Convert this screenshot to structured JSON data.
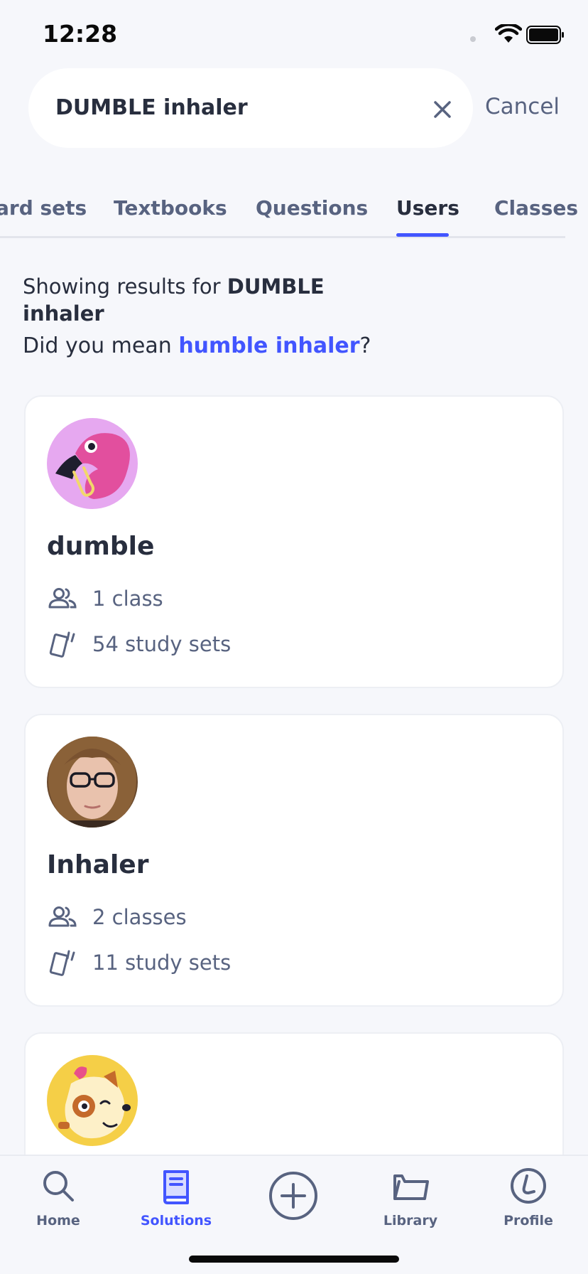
{
  "status_bar": {
    "time": "12:28"
  },
  "search": {
    "query": "DUMBLE inhaler",
    "cancel_label": "Cancel"
  },
  "tabs": [
    {
      "label": "ard sets"
    },
    {
      "label": "Textbooks"
    },
    {
      "label": "Questions"
    },
    {
      "label": "Users",
      "active": true
    },
    {
      "label": "Classes"
    }
  ],
  "results": {
    "showing_prefix": "Showing results for",
    "query": "DUMBLE inhaler",
    "did_you_mean_prefix": "Did you mean",
    "suggestion": "humble inhaler",
    "suggestion_suffix": "?"
  },
  "users": [
    {
      "name": "dumble",
      "classes": "1 class",
      "study_sets": "54 study sets",
      "avatar": "flamingo-avatar"
    },
    {
      "name": "Inhaler",
      "classes": "2 classes",
      "study_sets": "11 study sets",
      "avatar": "photo-avatar"
    },
    {
      "name": "",
      "avatar": "dog-avatar"
    }
  ],
  "bottom_nav": [
    {
      "label": "Home",
      "icon": "search-icon"
    },
    {
      "label": "Solutions",
      "icon": "book-icon",
      "active": true
    },
    {
      "label": "",
      "icon": "plus-circle-icon"
    },
    {
      "label": "Library",
      "icon": "folder-icon"
    },
    {
      "label": "Profile",
      "icon": "profile-icon"
    }
  ],
  "colors": {
    "accent": "#4255ff",
    "text": "#282e3e",
    "muted": "#586380",
    "background": "#f6f7fb"
  }
}
